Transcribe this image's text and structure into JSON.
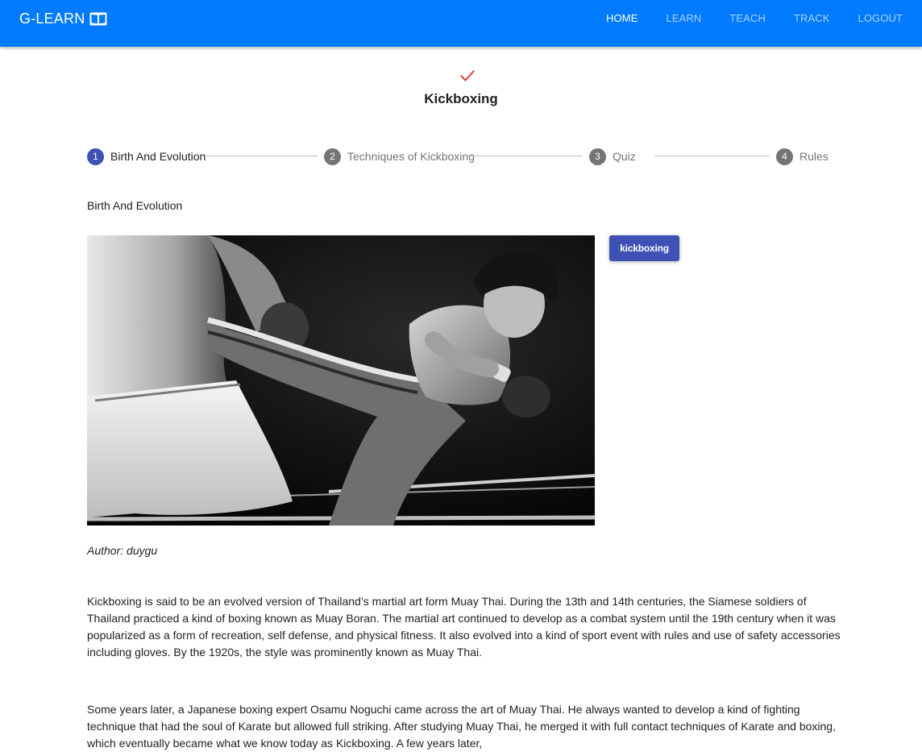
{
  "app": {
    "brand": "G-LEARN"
  },
  "nav": {
    "items": [
      {
        "label": "HOME",
        "active": true
      },
      {
        "label": "LEARN",
        "active": false
      },
      {
        "label": "TEACH",
        "active": false
      },
      {
        "label": "TRACK",
        "active": false
      },
      {
        "label": "LOGOUT",
        "active": false
      }
    ]
  },
  "course": {
    "title": "Kickboxing"
  },
  "stepper": {
    "steps": [
      {
        "number": "1",
        "label": "Birth And Evolution",
        "active": true
      },
      {
        "number": "2",
        "label": "Techniques of Kickboxing",
        "active": false
      },
      {
        "number": "3",
        "label": "Quiz",
        "active": false
      },
      {
        "number": "4",
        "label": "Rules",
        "active": false
      }
    ]
  },
  "content": {
    "section_title": "Birth And Evolution",
    "tag_label": "kickboxing",
    "author": "Author: duygu",
    "paragraphs": [
      "Kickboxing is said to be an evolved version of Thailand’s martial art form Muay Thai. During the 13th and 14th centuries, the Siamese soldiers of Thailand practiced a kind of boxing known as Muay Boran. The martial art continued to develop as a combat system until the 19th century when it was popularized as a form of recreation, self defense, and physical fitness. It also evolved into a kind of sport event with rules and use of safety accessories including gloves. By the 1920s, the style was prominently known as Muay Thai.",
      "Some years later, a Japanese boxing expert Osamu Noguchi came across the art of Muay Thai. He always wanted to develop a kind of fighting technique that had the soul of Karate but allowed full striking. After studying Muay Thai, he merged it with full contact techniques of Karate and boxing, which eventually became what we know today as Kickboxing. A few years later,"
    ]
  },
  "colors": {
    "appbar": "#007bff",
    "active_step": "#3f51b5",
    "inactive_step": "#757575",
    "check": "#e53935",
    "tag_button": "#3f51b5"
  },
  "icons": {
    "brand": "open-book-icon",
    "header": "check-icon"
  }
}
